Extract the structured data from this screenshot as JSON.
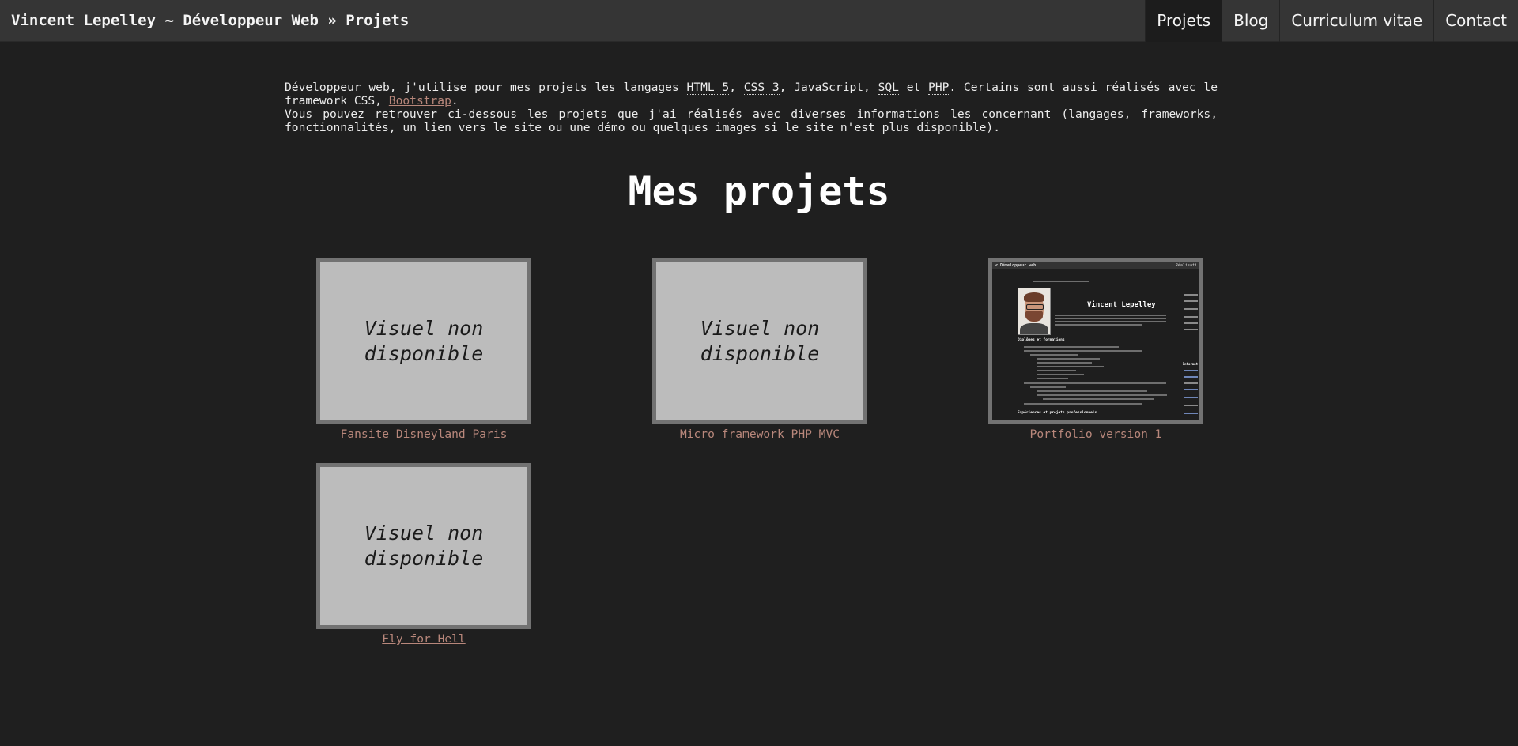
{
  "header": {
    "title": "Vincent Lepelley ~ Développeur Web » Projets",
    "nav": [
      {
        "label": "Projets",
        "active": true
      },
      {
        "label": "Blog",
        "active": false
      },
      {
        "label": "Curriculum vitae",
        "active": false
      },
      {
        "label": "Contact",
        "active": false
      }
    ]
  },
  "intro": {
    "p1_start": "Développeur web, j'utilise pour mes projets les langages ",
    "html": "HTML 5",
    "sep1": ", ",
    "css": "CSS 3",
    "sep2": ", JavaScript, ",
    "sql": "SQL",
    "sep3": " et ",
    "php": "PHP",
    "p1_mid": ". Certains sont aussi réalisés avec le framework CSS, ",
    "bootstrap": "Bootstrap",
    "p1_end": ".",
    "p2": "Vous pouvez retrouver ci-dessous les projets que j'ai réalisés avec diverses informations les concernant (langages, frameworks, fonctionnalités, un lien vers le site ou une démo ou quelques images si le site n'est plus disponible)."
  },
  "heading": "Mes projets",
  "placeholder_text": "Visuel non\ndisponible",
  "projects": [
    {
      "name": "Fansite Disneyland Paris",
      "thumbnail": "placeholder"
    },
    {
      "name": "Micro framework PHP MVC",
      "thumbnail": "placeholder"
    },
    {
      "name": "Portfolio version 1",
      "thumbnail": "screenshot"
    },
    {
      "name": "Fly for Hell",
      "thumbnail": "placeholder"
    }
  ],
  "mini_screenshot": {
    "bar_title": "< Développeur web",
    "bar_right": "Réalisati",
    "name": "Vincent Lepelley",
    "section1": "Diplômes et formations",
    "section2": "Expériences et projets professionnels",
    "side_title": "Informat"
  },
  "colors": {
    "background": "#1f1f1f",
    "topbar": "#353535",
    "link": "#b8877b",
    "thumb_border": "#727272",
    "thumb_fill": "#bcbcbc"
  }
}
